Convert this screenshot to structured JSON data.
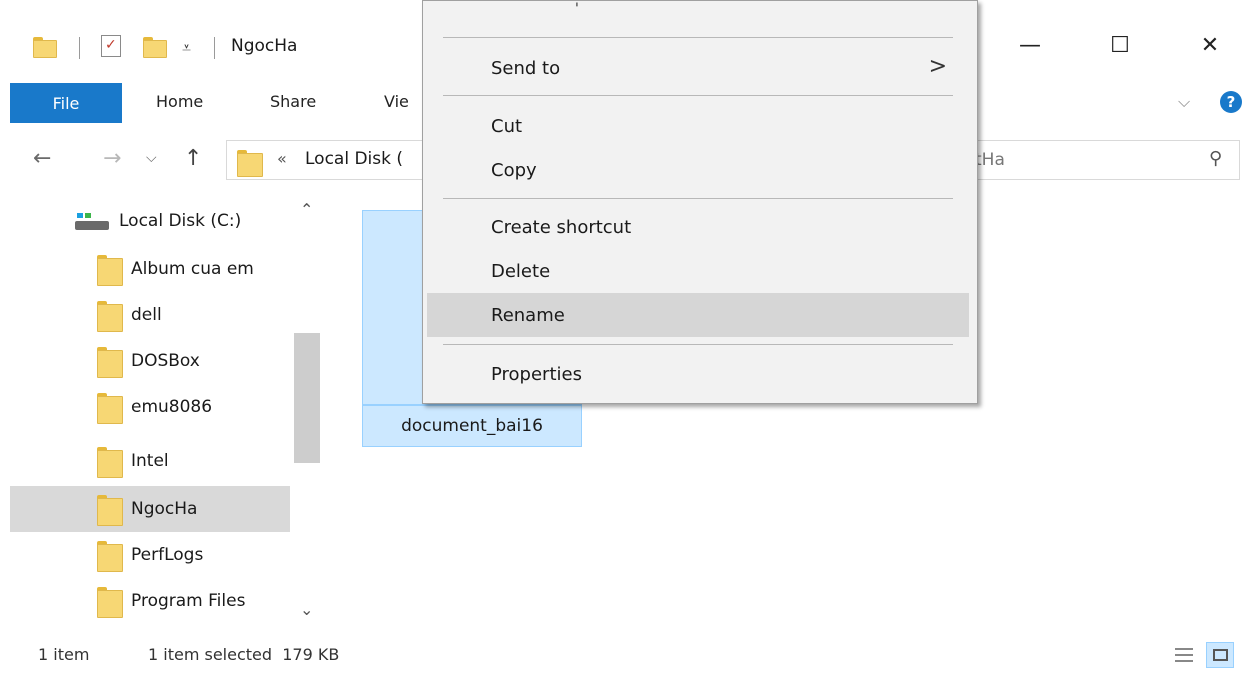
{
  "window": {
    "title": "NgocHa",
    "controls": {
      "minimize": "—",
      "maximize": "☐",
      "close": "✕"
    }
  },
  "ribbon": {
    "tabs": [
      "File",
      "Home",
      "Share",
      "Vie"
    ],
    "help": "?"
  },
  "address": {
    "chevron": "«",
    "path": "Local Disk (",
    "search_fragment": "tHa"
  },
  "nav_pane": {
    "root": "Local Disk (C:)",
    "items": [
      {
        "label": "Album cua em"
      },
      {
        "label": "dell"
      },
      {
        "label": "DOSBox"
      },
      {
        "label": "emu8086"
      },
      {
        "label": "Intel"
      },
      {
        "label": "NgocHa",
        "selected": true
      },
      {
        "label": "PerfLogs"
      },
      {
        "label": "Program Files"
      }
    ]
  },
  "content": {
    "file_name": "document_bai16"
  },
  "context_menu": {
    "top_fragment": "'",
    "items": [
      {
        "label": "Send to",
        "submenu": true
      },
      {
        "label": "Cut"
      },
      {
        "label": "Copy"
      },
      {
        "label": "Create shortcut"
      },
      {
        "label": "Delete"
      },
      {
        "label": "Rename",
        "highlighted": true
      },
      {
        "label": "Properties"
      }
    ],
    "submenu_arrow": ">"
  },
  "status_bar": {
    "count": "1 item",
    "selection": "1 item selected  179 KB"
  },
  "colors": {
    "accent": "#1979ca",
    "selection_fill": "#cce8ff",
    "menu_bg": "#f2f2f2",
    "menu_hover": "#d6d6d6",
    "folder_yellow": "#f7d774"
  }
}
